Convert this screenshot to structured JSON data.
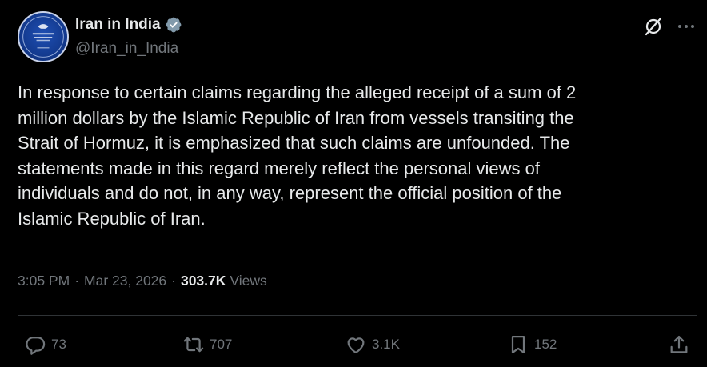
{
  "account": {
    "display_name": "Iran in India",
    "handle": "@Iran_in_India",
    "verified": true
  },
  "tweet": {
    "text": "In response to certain claims regarding the alleged receipt of a sum of 2\nmillion dollars by the Islamic Republic of Iran from vessels transiting the\nStrait of Hormuz, it is emphasized that such claims are unfounded. The\nstatements made in this regard merely reflect the personal views of\nindividuals and do not, in any way, represent the official position of the\nIslamic Republic of Iran.",
    "time": "3:05 PM",
    "date": "Mar 23, 2026",
    "separator": "·",
    "views_count": "303.7K",
    "views_label": "Views"
  },
  "actions": {
    "replies": "73",
    "reposts": "707",
    "likes": "3.1K",
    "bookmarks": "152"
  },
  "icons": {
    "verified": "verified-badge-icon",
    "grok": "grok-icon",
    "more": "more-dots-icon",
    "reply": "reply-icon",
    "repost": "repost-icon",
    "like": "heart-icon",
    "bookmark": "bookmark-icon",
    "share": "share-icon"
  },
  "colors": {
    "background": "#000000",
    "text": "#e7e9ea",
    "muted": "#71767b",
    "divider": "#2f3336"
  }
}
